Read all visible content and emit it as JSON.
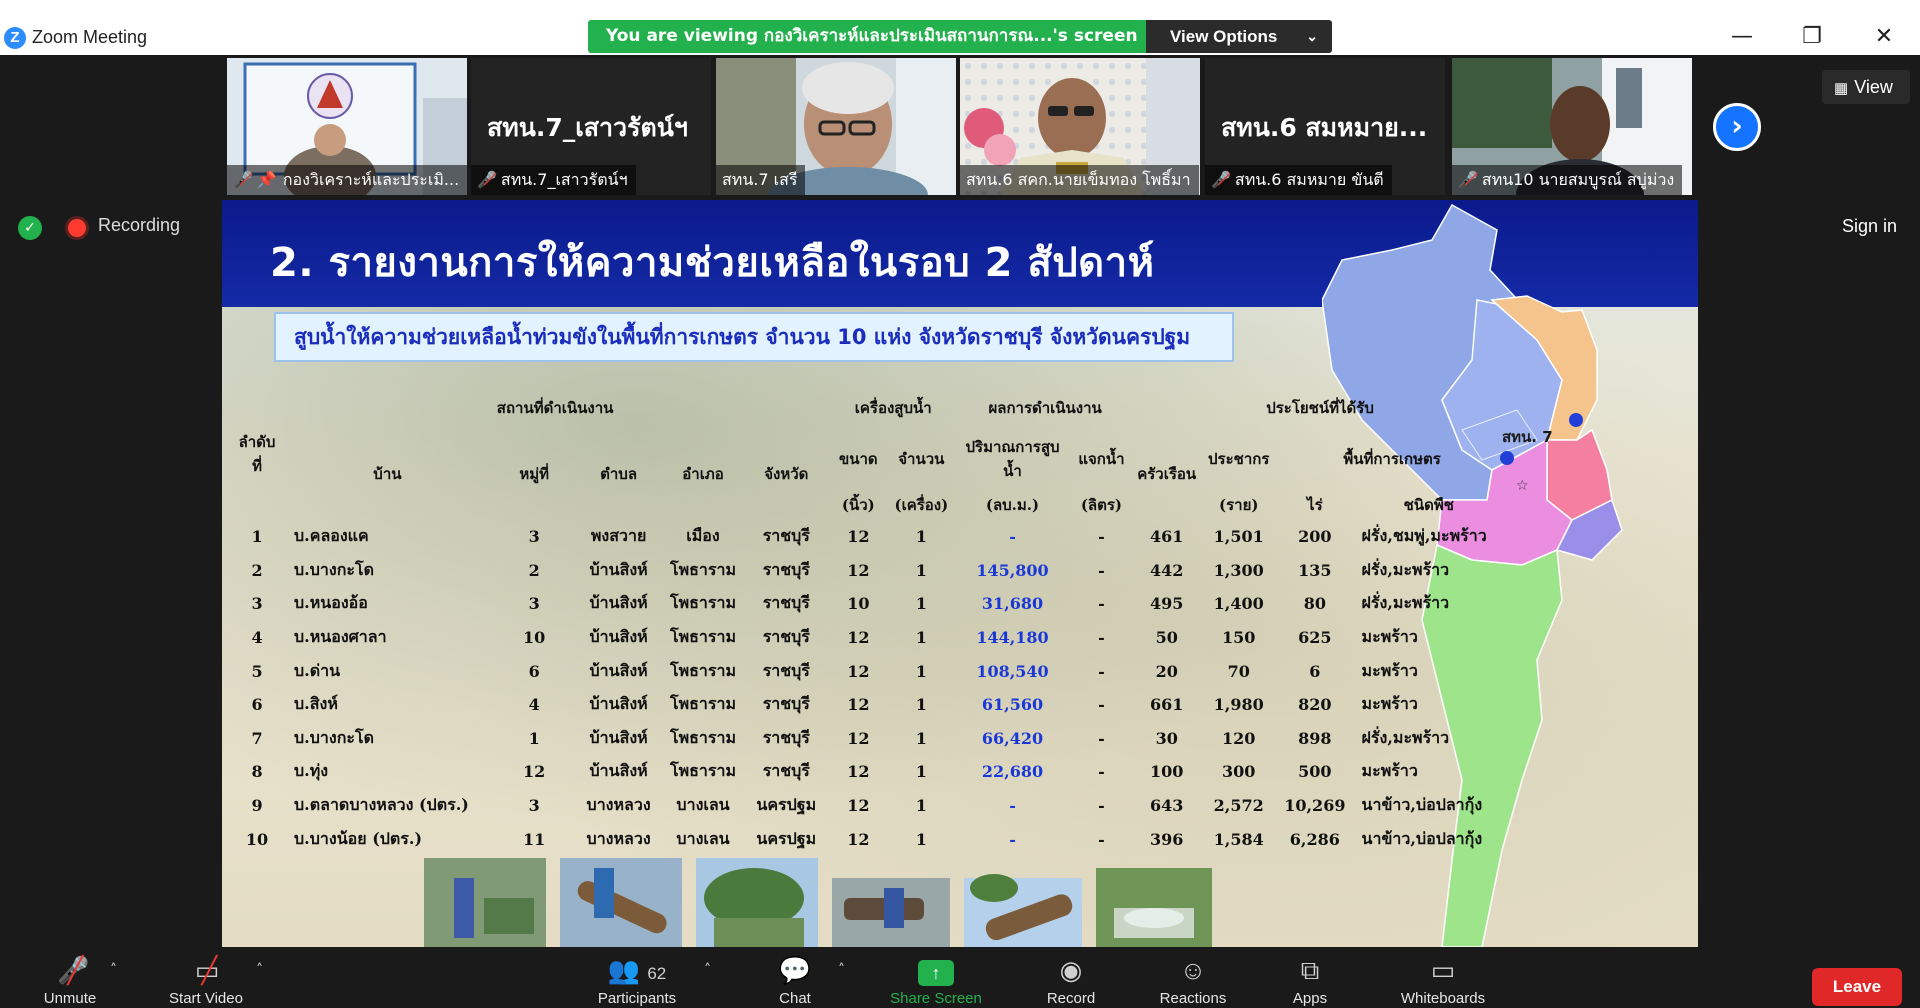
{
  "window": {
    "app_title": "Zoom Meeting",
    "logo_glyph": "Z",
    "minimize": "—",
    "restore": "❐",
    "close": "✕"
  },
  "share_banner": {
    "text": "You are viewing กองวิเคราะห์และประเมินสถานการณ...'s screen",
    "options_label": "View Options"
  },
  "participants_strip": [
    {
      "name_bar": "กองวิเคราะห์และประเมิ...",
      "muted": true,
      "pinned": true,
      "video": true
    },
    {
      "big_name": "สทน.7_เสาวรัตน์ฯ",
      "name_bar": "สทน.7_เสาวรัตน์ฯ",
      "muted": true,
      "video": false
    },
    {
      "name_bar": "สทน.7 เสรี",
      "muted": false,
      "video": true,
      "active_speaker": true
    },
    {
      "name_bar": "สทน.6 สคก.นายเข็มทอง โพธิ์มา",
      "muted": false,
      "video": true
    },
    {
      "big_name": "สทน.6 สมหมาย...",
      "name_bar": "สทน.6 สมหมาย  ขันตี",
      "muted": true,
      "video": false
    },
    {
      "name_bar": "สทน10 นายสมบูรณ์ สบู่ม่วง",
      "muted": true,
      "video": true
    }
  ],
  "view_button": "View",
  "recording_label": "Recording",
  "sign_in": "Sign in",
  "slide": {
    "title": "2. รายงานการให้ความช่วยเหลือในรอบ 2 สัปดาห์",
    "subtitle": "สูบน้ำให้ความช่วยเหลือน้ำท่วมขังในพื้นที่การเกษตร จำนวน 10 แห่ง จังหวัดราชบุรี จังหวัดนครปฐม",
    "table": {
      "group_headers": {
        "location": "สถานที่ดำเนินงาน",
        "pump": "เครื่องสูบน้ำ",
        "result": "ผลการดำเนินงาน",
        "benefit": "ประโยชน์ที่ได้รับ",
        "agri_area": "พื้นที่การเกษตร"
      },
      "headers": {
        "no": "ลำดับที่",
        "village": "บ้าน",
        "moo": "หมู่ที่",
        "tambon": "ตำบล",
        "amphoe": "อำเภอ",
        "province": "จังหวัด",
        "size": "ขนาด",
        "size_unit": "(นิ้ว)",
        "count": "จำนวน",
        "count_unit": "(เครื่อง)",
        "volume": "ปริมาณการสูบน้ำ",
        "volume_unit": "(ลบ.ม.)",
        "water_dist": "แจกน้ำ",
        "water_dist_unit": "(ลิตร)",
        "households": "ครัวเรือน",
        "population": "ประชากร",
        "population_unit": "(ราย)",
        "rai": "ไร่",
        "crop": "ชนิดพืช"
      },
      "rows": [
        {
          "no": "1",
          "village": "บ.คลองแค",
          "moo": "3",
          "tambon": "พงสวาย",
          "amphoe": "เมือง",
          "province": "ราชบุรี",
          "size": "12",
          "count": "1",
          "volume": "-",
          "water": "-",
          "households": "461",
          "population": "1,501",
          "rai": "200",
          "crop": "ฝรั่ง,ชมพู่,มะพร้าว"
        },
        {
          "no": "2",
          "village": "บ.บางกะโด",
          "moo": "2",
          "tambon": "บ้านสิงห์",
          "amphoe": "โพธาราม",
          "province": "ราชบุรี",
          "size": "12",
          "count": "1",
          "volume": "145,800",
          "water": "-",
          "households": "442",
          "population": "1,300",
          "rai": "135",
          "crop": "ฝรั่ง,มะพร้าว"
        },
        {
          "no": "3",
          "village": "บ.หนองอ้อ",
          "moo": "3",
          "tambon": "บ้านสิงห์",
          "amphoe": "โพธาราม",
          "province": "ราชบุรี",
          "size": "10",
          "count": "1",
          "volume": "31,680",
          "water": "-",
          "households": "495",
          "population": "1,400",
          "rai": "80",
          "crop": "ฝรั่ง,มะพร้าว"
        },
        {
          "no": "4",
          "village": "บ.หนองศาลา",
          "moo": "10",
          "tambon": "บ้านสิงห์",
          "amphoe": "โพธาราม",
          "province": "ราชบุรี",
          "size": "12",
          "count": "1",
          "volume": "144,180",
          "water": "-",
          "households": "50",
          "population": "150",
          "rai": "625",
          "crop": "มะพร้าว"
        },
        {
          "no": "5",
          "village": "บ.ด่าน",
          "moo": "6",
          "tambon": "บ้านสิงห์",
          "amphoe": "โพธาราม",
          "province": "ราชบุรี",
          "size": "12",
          "count": "1",
          "volume": "108,540",
          "water": "-",
          "households": "20",
          "population": "70",
          "rai": "6",
          "crop": "มะพร้าว"
        },
        {
          "no": "6",
          "village": "บ.สิงห์",
          "moo": "4",
          "tambon": "บ้านสิงห์",
          "amphoe": "โพธาราม",
          "province": "ราชบุรี",
          "size": "12",
          "count": "1",
          "volume": "61,560",
          "water": "-",
          "households": "661",
          "population": "1,980",
          "rai": "820",
          "crop": "มะพร้าว"
        },
        {
          "no": "7",
          "village": "บ.บางกะโด",
          "moo": "1",
          "tambon": "บ้านสิงห์",
          "amphoe": "โพธาราม",
          "province": "ราชบุรี",
          "size": "12",
          "count": "1",
          "volume": "66,420",
          "water": "-",
          "households": "30",
          "population": "120",
          "rai": "898",
          "crop": "ฝรั่ง,มะพร้าว"
        },
        {
          "no": "8",
          "village": "บ.ทุ่ง",
          "moo": "12",
          "tambon": "บ้านสิงห์",
          "amphoe": "โพธาราม",
          "province": "ราชบุรี",
          "size": "12",
          "count": "1",
          "volume": "22,680",
          "water": "-",
          "households": "100",
          "population": "300",
          "rai": "500",
          "crop": "มะพร้าว"
        },
        {
          "no": "9",
          "village": "บ.ตลาดบางหลวง (ปตร.)",
          "moo": "3",
          "tambon": "บางหลวง",
          "amphoe": "บางเลน",
          "province": "นครปฐม",
          "size": "12",
          "count": "1",
          "volume": "-",
          "water": "-",
          "households": "643",
          "population": "2,572",
          "rai": "10,269",
          "crop": "นาข้าว,บ่อปลากุ้ง"
        },
        {
          "no": "10",
          "village": "บ.บางน้อย (ปตร.)",
          "moo": "11",
          "tambon": "บางหลวง",
          "amphoe": "บางเลน",
          "province": "นครปฐม",
          "size": "12",
          "count": "1",
          "volume": "-",
          "water": "-",
          "households": "396",
          "population": "1,584",
          "rai": "6,286",
          "crop": "นาข้าว,บ่อปลากุ้ง"
        }
      ]
    },
    "map_label": "สทน. 7"
  },
  "toolbar": {
    "unmute": "Unmute",
    "start_video": "Start Video",
    "participants_count": "62",
    "participants": "Participants",
    "chat": "Chat",
    "share_screen": "Share Screen",
    "record": "Record",
    "reactions": "Reactions",
    "apps": "Apps",
    "whiteboards": "Whiteboards",
    "leave": "Leave"
  },
  "colors": {
    "banner_green": "#23b14d",
    "slide_header_blue": "#0a1a8c",
    "value_blue": "#1a38d8",
    "leave_red": "#e02828",
    "next_button_blue": "#1473ff"
  }
}
